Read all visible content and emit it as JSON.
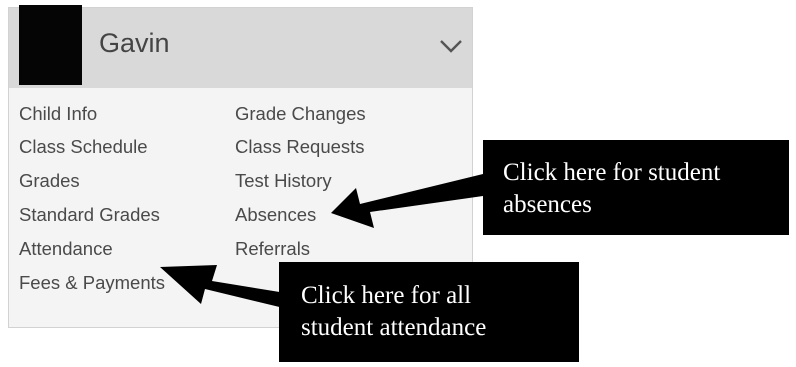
{
  "selector": {
    "child_name": "Gavin",
    "avatar_icon": "avatar-placeholder",
    "toggle_icon": "chevron-down-icon"
  },
  "menu": {
    "left_column": [
      "Child Info",
      "Class Schedule",
      "Grades",
      "Standard Grades",
      "Attendance",
      "Fees & Payments"
    ],
    "right_column": [
      "Grade Changes",
      "Class Requests",
      "Test History",
      "Absences",
      "Referrals"
    ]
  },
  "callouts": {
    "absences": {
      "line1": "Click here for student",
      "line2": "absences"
    },
    "attendance": {
      "line1": "Click here for all",
      "line2": "student attendance"
    }
  },
  "colors": {
    "panel_bg": "#f4f4f4",
    "header_bg": "#d9d9d9",
    "menu_text": "#4a4a4a",
    "callout_bg": "#000000",
    "callout_text": "#ffffff"
  }
}
